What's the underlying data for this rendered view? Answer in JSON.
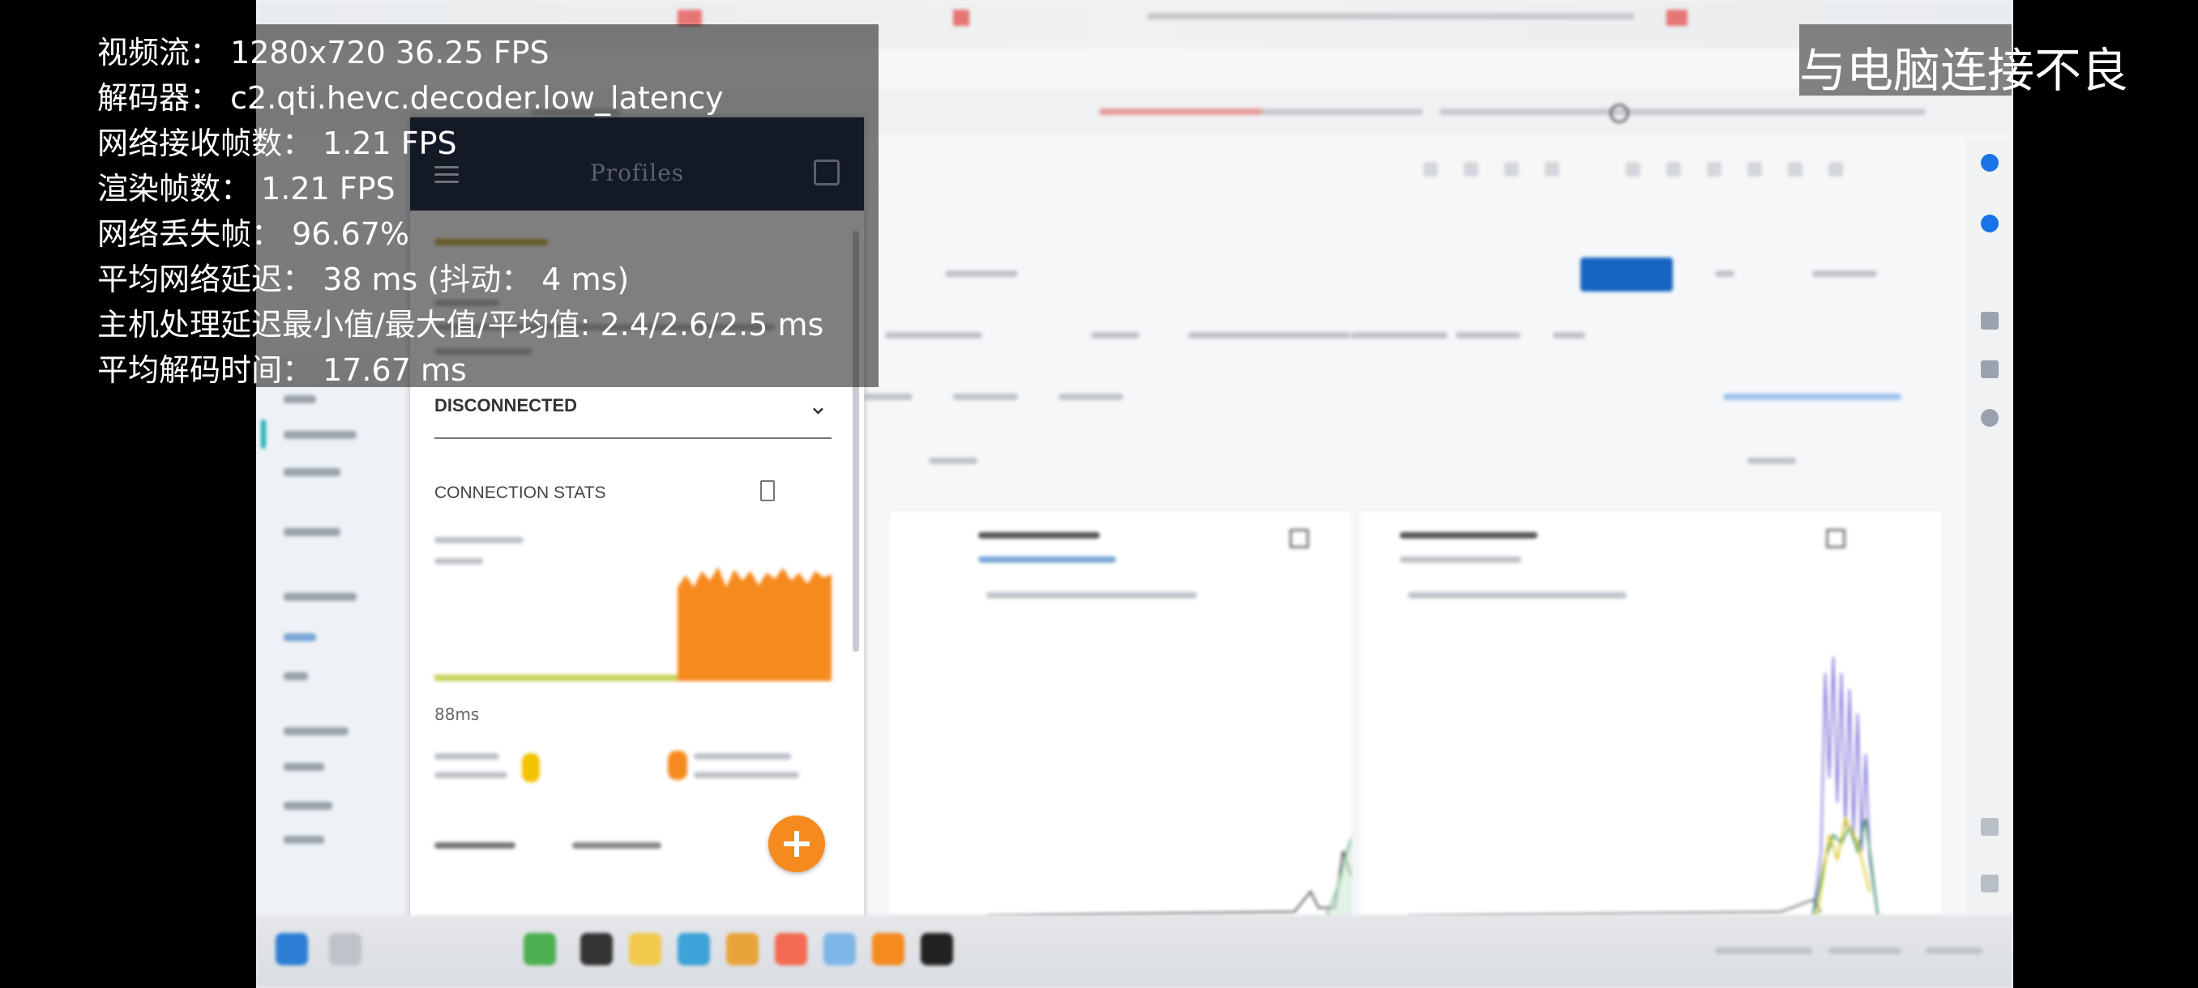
{
  "stream_stats": {
    "video_stream": "视频流： 1280x720 36.25 FPS",
    "decoder": "解码器： c2.qti.hevc.decoder.low_latency",
    "network_fps": "网络接收帧数： 1.21 FPS",
    "render_fps": "渲染帧数： 1.21 FPS",
    "frame_loss": "网络丢失帧： 96.67%",
    "avg_latency": "平均网络延迟： 38 ms (抖动： 4 ms)",
    "host_latency": "主机处理延迟最小值/最大值/平均值: 2.4/2.6/2.5 ms",
    "decode_time": "平均解码时间： 17.67 ms"
  },
  "connection_warning": "与电脑连接不良",
  "profile_panel": {
    "title": "Profiles",
    "status": "DISCONNECTED",
    "stats_title": "CONNECTION STATS",
    "axis_label": "88ms"
  },
  "colors": {
    "accent_orange": "#f58a1f",
    "panel_header": "#27324a",
    "primary_button": "#1565c0",
    "chart_green": "#2e8b57",
    "chart_purple": "#7b6fd6"
  }
}
